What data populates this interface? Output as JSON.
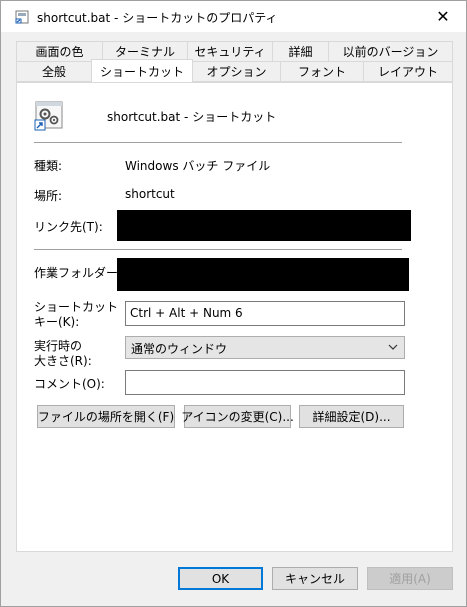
{
  "window": {
    "title": "shortcut.bat - ショートカットのプロパティ",
    "close_glyph": "✕"
  },
  "tabs": {
    "row1": [
      "画面の色",
      "ターミナル",
      "セキュリティ",
      "詳細",
      "以前のバージョン"
    ],
    "row2": [
      "全般",
      "ショートカット",
      "オプション",
      "フォント",
      "レイアウト"
    ],
    "active": "ショートカット"
  },
  "header": {
    "name": "shortcut.bat - ショートカット",
    "icon": "batch-file-shortcut-icon"
  },
  "fields": {
    "type_label": "種類:",
    "type_value": "Windows バッチ ファイル",
    "location_label": "場所:",
    "location_value": "shortcut",
    "target_label": "リンク先(T):",
    "workdir_label": "作業フォルダー(S):",
    "hotkey_label_1": "ショートカット",
    "hotkey_label_2": "キー(K):",
    "hotkey_value": "Ctrl + Alt + Num 6",
    "run_label_1": "実行時の",
    "run_label_2": "大きさ(R):",
    "run_value": "通常のウィンドウ",
    "comment_label": "コメント(O):",
    "comment_value": ""
  },
  "buttons": {
    "open_location": "ファイルの場所を開く(F)",
    "change_icon": "アイコンの変更(C)...",
    "advanced": "詳細設定(D)...",
    "ok": "OK",
    "cancel": "キャンセル",
    "apply": "適用(A)"
  },
  "colors": {
    "accent": "#0078d7",
    "redaction": "#000000"
  }
}
